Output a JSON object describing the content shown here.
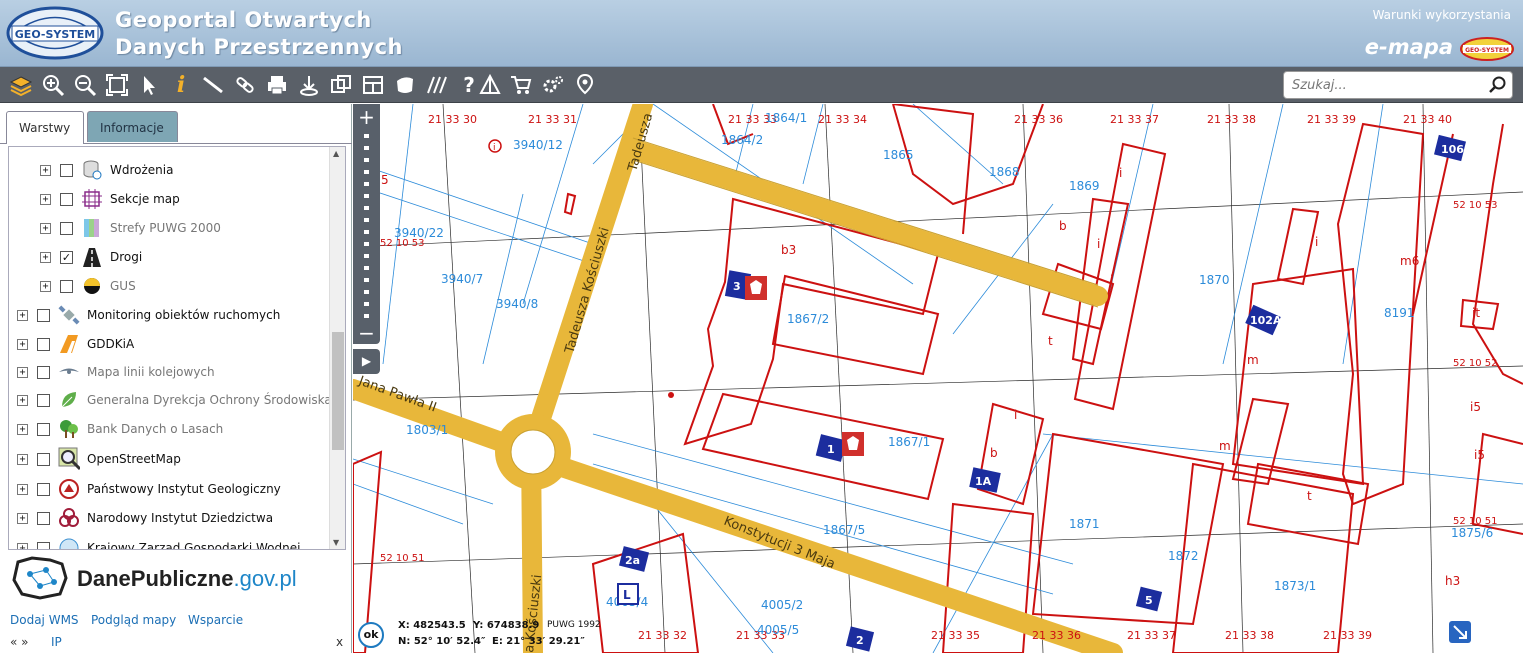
{
  "header": {
    "logo_text": "GEO-SYSTEM",
    "title_line1": "Geoportal Otwartych",
    "title_line2": "Danych Przestrzennych",
    "terms_link": "Warunki wykorzystania",
    "brand": "e-mapa",
    "brand_logo_text": "GEO-SYSTEM"
  },
  "toolbar": {
    "icons": [
      "layers-icon",
      "zoom-in-icon",
      "zoom-out-icon",
      "zoom-extent-icon",
      "pointer-icon",
      "info-icon",
      "measure-icon",
      "link-icon",
      "print-icon",
      "download-icon",
      "copy-icon",
      "layout-icon",
      "shape-icon",
      "hatch-icon",
      "help-icon",
      "triangle-icon",
      "cart-icon",
      "settings-icon",
      "location-icon"
    ],
    "search_placeholder": "Szukaj..."
  },
  "left_panel": {
    "tabs": [
      {
        "label": "Warstwy"
      },
      {
        "label": "Informacje"
      }
    ],
    "tree": [
      {
        "label": "Wdrożenia",
        "indent": 1,
        "checked": false,
        "greyed": false
      },
      {
        "label": "Sekcje map",
        "indent": 1,
        "checked": false,
        "greyed": false
      },
      {
        "label": "Strefy PUWG 2000",
        "indent": 1,
        "checked": false,
        "greyed": true
      },
      {
        "label": "Drogi",
        "indent": 1,
        "checked": true,
        "greyed": false
      },
      {
        "label": "GUS",
        "indent": 1,
        "checked": false,
        "greyed": true
      },
      {
        "label": "Monitoring obiektów ruchomych",
        "indent": 0,
        "checked": false,
        "greyed": false
      },
      {
        "label": "GDDKiA",
        "indent": 0,
        "checked": false,
        "greyed": false
      },
      {
        "label": "Mapa linii kolejowych",
        "indent": 0,
        "checked": false,
        "greyed": true
      },
      {
        "label": "Generalna Dyrekcja Ochrony Środowiska",
        "indent": 0,
        "checked": false,
        "greyed": true
      },
      {
        "label": "Bank Danych o Lasach",
        "indent": 0,
        "checked": false,
        "greyed": true
      },
      {
        "label": "OpenStreetMap",
        "indent": 0,
        "checked": false,
        "greyed": false
      },
      {
        "label": "Państwowy Instytut Geologiczny",
        "indent": 0,
        "checked": false,
        "greyed": false
      },
      {
        "label": "Narodowy Instytut Dziedzictwa",
        "indent": 0,
        "checked": false,
        "greyed": false
      },
      {
        "label": "Krajowy Zarząd Gospodarki Wodnej",
        "indent": 0,
        "checked": false,
        "greyed": false
      }
    ],
    "banner": {
      "main": "DanePubliczne",
      "suffix": ".gov.pl"
    },
    "footer_links": [
      "Dodaj WMS",
      "Podgląd mapy",
      "Wsparcie"
    ],
    "nav": "« »",
    "ip": "IP",
    "close": "x"
  },
  "map": {
    "streets": [
      "Tadeusza",
      "Tadeusza Kościuszki",
      "Jana Pawła II",
      "Konstytucji 3 Maja",
      "a Kościuszki"
    ],
    "section_labels": [
      "21 33 30",
      "21 33 31",
      "21 33 33",
      "21 33 34",
      "21 33 36",
      "21 33 37",
      "21 33 38",
      "21 33 39",
      "21 33 40",
      "21 33 32",
      "21 33 33",
      "21 33 35",
      "21 33 36",
      "21 33 37",
      "21 33 38",
      "21 33 39"
    ],
    "grid_labels": [
      "52 10 53",
      "52 10 53",
      "52 10 52",
      "52 10 51",
      "52 10 51"
    ],
    "parcels": [
      "3940/12",
      "1864/1",
      "1864/2",
      "1865",
      "1868",
      "1869",
      "3940/22",
      "3940/7",
      "3940/8",
      "1867/2",
      "1870",
      "8191",
      "1803/1",
      "1867/1",
      "1867/5",
      "1871",
      "1872",
      "1873/1",
      "1875/6",
      "4005/2",
      "4005/4",
      "4005/5"
    ],
    "building_labels": [
      "b3",
      "b",
      "i",
      "i",
      "i",
      "i",
      "t",
      "m",
      "m6",
      "it",
      "i5",
      "i5",
      "b",
      "i",
      "m",
      "t",
      "h3",
      "5"
    ],
    "house_numbers": [
      "3",
      "1",
      "1A",
      "102A",
      "106",
      "2a",
      "2",
      "5"
    ],
    "coords": {
      "ok_label": "ok",
      "x_label": "X: 482543.5",
      "y_label": "Y: 674838.9",
      "system": "PUWG 1992",
      "n_label": "N: 52° 10′ 52.4″",
      "e_label": "E: 21° 33′ 29.21″"
    }
  }
}
